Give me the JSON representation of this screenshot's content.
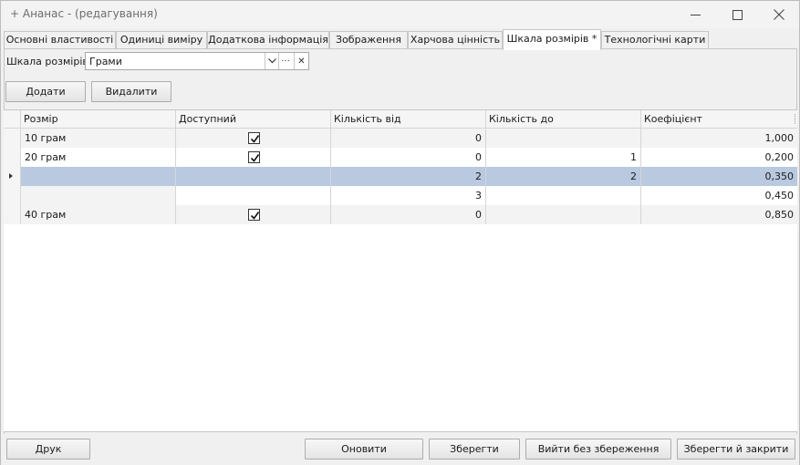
{
  "window": {
    "title": "+ Ананас - (редагування)"
  },
  "tabs": [
    {
      "label": "Основні властивості",
      "active": false
    },
    {
      "label": "Одиниці виміру",
      "active": false
    },
    {
      "label": "Додаткова інформація",
      "active": false
    },
    {
      "label": "Зображення",
      "active": false
    },
    {
      "label": "Харчова цінність",
      "active": false
    },
    {
      "label": "Шкала розмірів *",
      "active": true
    },
    {
      "label": "Технологічні карти",
      "active": false
    }
  ],
  "size_scale": {
    "label": "Шкала розмірів:",
    "value": "Грами",
    "dots_label": "···",
    "clear_label": "✕"
  },
  "toolbar": {
    "add_label": "Додати",
    "delete_label": "Видалити"
  },
  "grid": {
    "columns": [
      "Розмір",
      "Доступний",
      "Кількість від",
      "Кількість до",
      "Коефіцієнт"
    ],
    "rows": [
      {
        "size": "10 грам",
        "available": true,
        "qty_from": "0",
        "qty_to": "",
        "coef": "1,000",
        "selected": false
      },
      {
        "size": "20 грам",
        "available": true,
        "qty_from": "0",
        "qty_to": "1",
        "coef": "0,200",
        "selected": false
      },
      {
        "size": "",
        "available": false,
        "qty_from": "2",
        "qty_to": "2",
        "coef": "0,350",
        "selected": true
      },
      {
        "size": "",
        "available": false,
        "qty_from": "3",
        "qty_to": "",
        "coef": "0,450",
        "selected": false
      },
      {
        "size": "40 грам",
        "available": true,
        "qty_from": "0",
        "qty_to": "",
        "coef": "0,850",
        "selected": false
      }
    ]
  },
  "footer": {
    "print_label": "Друк",
    "refresh_label": "Оновити",
    "save_label": "Зберегти",
    "exit_label": "Вийти без збереження",
    "save_close_label": "Зберегти й закрити"
  },
  "colors": {
    "selected_row": "#b8c9e0",
    "alt_row": "#f3f3f3"
  }
}
